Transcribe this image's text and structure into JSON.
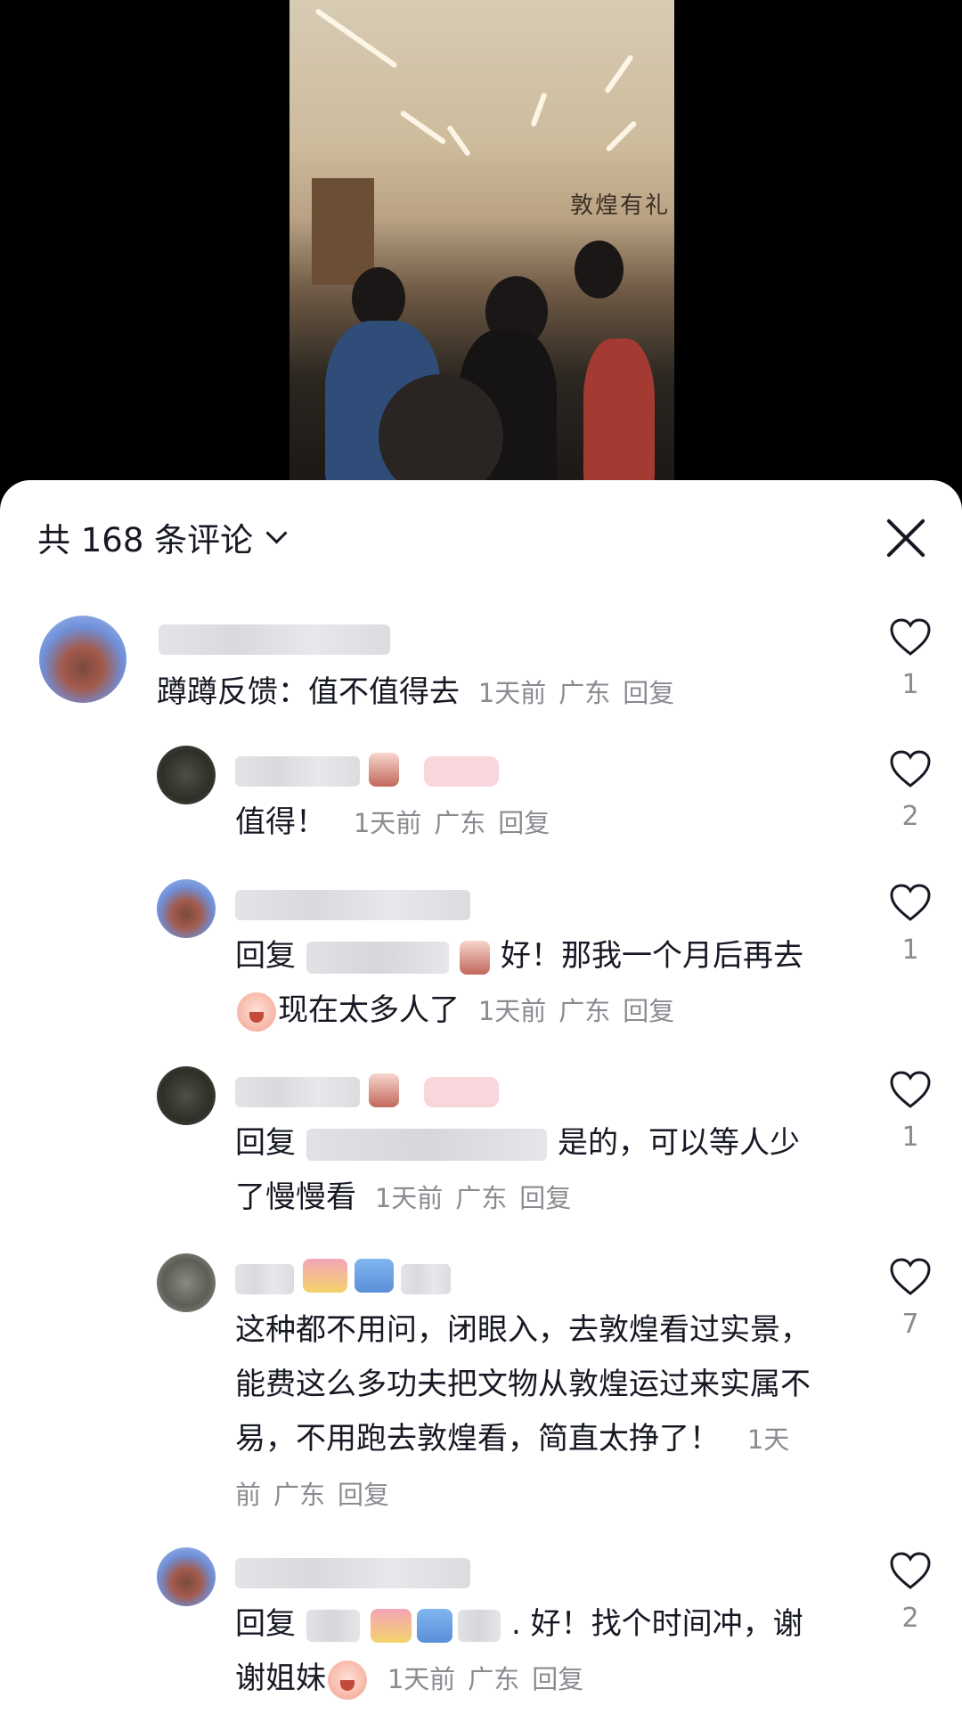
{
  "video": {
    "wall_sign": "敦煌有礼"
  },
  "header": {
    "title": "共 168 条评论",
    "close_icon": "close-icon",
    "chevron_icon": "chevron-down-icon"
  },
  "comments": [
    {
      "text": "蹲蹲反馈：值不值得去",
      "time": "1天前",
      "location": "广东",
      "reply": "回复",
      "likes": "1"
    },
    {
      "text": "值得！",
      "time": "1天前",
      "location": "广东",
      "reply": "回复",
      "likes": "2"
    },
    {
      "prefix": "回复",
      "text_a": "好！那我一个月后再",
      "text_b": "去",
      "text_c": "现在太多人了",
      "time": "1天前",
      "location": "广东",
      "reply": "回复",
      "likes": "1"
    },
    {
      "prefix": "回复",
      "text_a": "是的，可以等人",
      "text_b": "少了慢慢看",
      "time": "1天前",
      "location": "广东",
      "reply": "回复",
      "likes": "1"
    },
    {
      "text": "这种都不用问，闭眼入，去敦煌看过实景，能费这么多功夫把文物从敦煌运过来实属不易，不用跑去敦煌看，简直太挣了！",
      "time": "1天前",
      "location": "广东",
      "reply": "回复",
      "likes": "7"
    },
    {
      "prefix": "回复",
      "text_a": ". 好！找个时间冲，",
      "text_b": "谢谢姐妹",
      "time": "1天前",
      "location": "广东",
      "reply": "回复",
      "likes": "2"
    }
  ]
}
